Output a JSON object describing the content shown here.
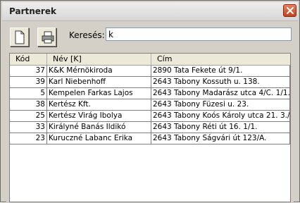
{
  "window": {
    "title": "Partnerek"
  },
  "toolbar": {
    "new_icon": "new-document-icon",
    "print_icon": "printer-icon"
  },
  "search": {
    "label": "Keresés:",
    "value": "k"
  },
  "table": {
    "headers": {
      "kod": "Kód",
      "nev": "Név [K]",
      "cim": "Cím"
    },
    "rows": [
      {
        "kod": "37",
        "nev": "K&K Mérnökiroda",
        "cim": "2890 Tata Fekete út 9/1."
      },
      {
        "kod": "39",
        "nev": "Karl Niebenhoff",
        "cim": "2643 Tabony Kossuth u. 138."
      },
      {
        "kod": "5",
        "nev": "Kempelen Farkas Lajos",
        "cim": "2643 Tabony Madarász utca 4/C. 1/1."
      },
      {
        "kod": "38",
        "nev": "Kertész Kft.",
        "cim": "2643 Tabony Füzesi u. 23."
      },
      {
        "kod": "25",
        "nev": "Kertész Virág Ibolya",
        "cim": "2643 Tabony Koós Károly utca 21. 3./1."
      },
      {
        "kod": "33",
        "nev": "Királyné Banás Ildikó",
        "cim": "2643 Tabony Réti út 16. 1/1."
      },
      {
        "kod": "23",
        "nev": "Kuruczné Labanc Erika",
        "cim": "2643 Tabony Ságvári út 123/A."
      }
    ]
  }
}
